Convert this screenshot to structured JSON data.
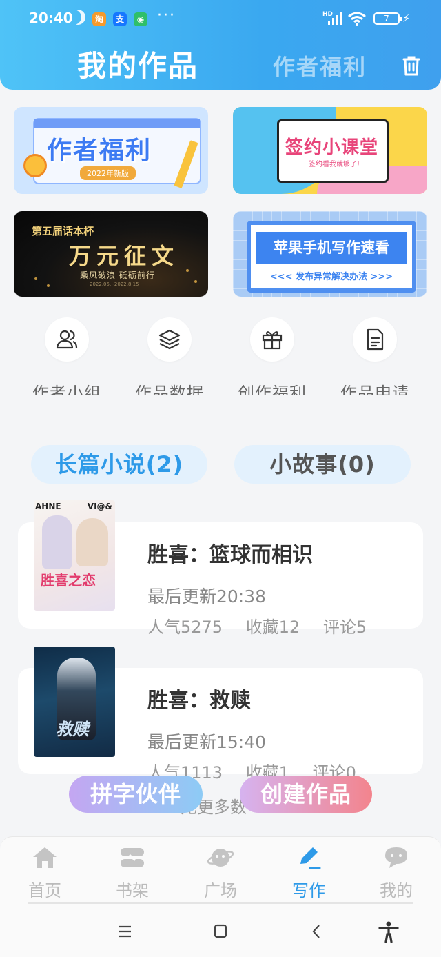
{
  "status": {
    "time": "20:40",
    "battery": "7",
    "hd": "HD",
    "app_badges": [
      "淘",
      "支",
      "◉"
    ]
  },
  "header": {
    "active_tab": "我的作品",
    "other_tab": "作者福利"
  },
  "banners": {
    "b1": {
      "title": "作者福利",
      "sub": "2022年新版"
    },
    "b2": {
      "title": "签约小课堂",
      "sub": "签约看我就够了!"
    },
    "b3": {
      "top": "第五届话本杯",
      "title": "万元征文",
      "sub": "乘风破浪 砥砺前行",
      "tiny": "2022.05.  -2022.8.15"
    },
    "b4": {
      "title": "苹果手机写作速看",
      "sub": "<<< 发布异常解决办法 >>>"
    }
  },
  "quick": [
    {
      "label": "作者小组",
      "icon": "users-icon"
    },
    {
      "label": "作品数据",
      "icon": "layers-icon"
    },
    {
      "label": "创作福利",
      "icon": "gift-icon"
    },
    {
      "label": "作品申请",
      "icon": "document-icon"
    }
  ],
  "categories": {
    "active": "长篇小说(2)",
    "inactive": "小故事(0)"
  },
  "works": [
    {
      "title": "胜喜：篮球而相识",
      "update": "最后更新20:38",
      "popularity": "人气5275",
      "favorites": "收藏12",
      "comments": "评论5",
      "cover_title": "胜喜之恋",
      "cover_left": "AHNE",
      "cover_right": "VI@&"
    },
    {
      "title": "胜喜：救赎",
      "update": "最后更新15:40",
      "popularity": "人气1113",
      "favorites": "收藏1",
      "comments": "评论0",
      "cover_title": "救赎"
    }
  ],
  "more_text": "无更多数",
  "fabs": {
    "partner": "拼字伙伴",
    "create": "创建作品"
  },
  "nav": [
    {
      "label": "首页",
      "icon": "home-icon"
    },
    {
      "label": "书架",
      "icon": "bookshelf-icon"
    },
    {
      "label": "广场",
      "icon": "planet-icon"
    },
    {
      "label": "写作",
      "icon": "pen-icon",
      "active": true
    },
    {
      "label": "我的",
      "icon": "chat-icon"
    }
  ],
  "colors": {
    "accent": "#2e9ae8",
    "header": "#3aa8f0"
  }
}
